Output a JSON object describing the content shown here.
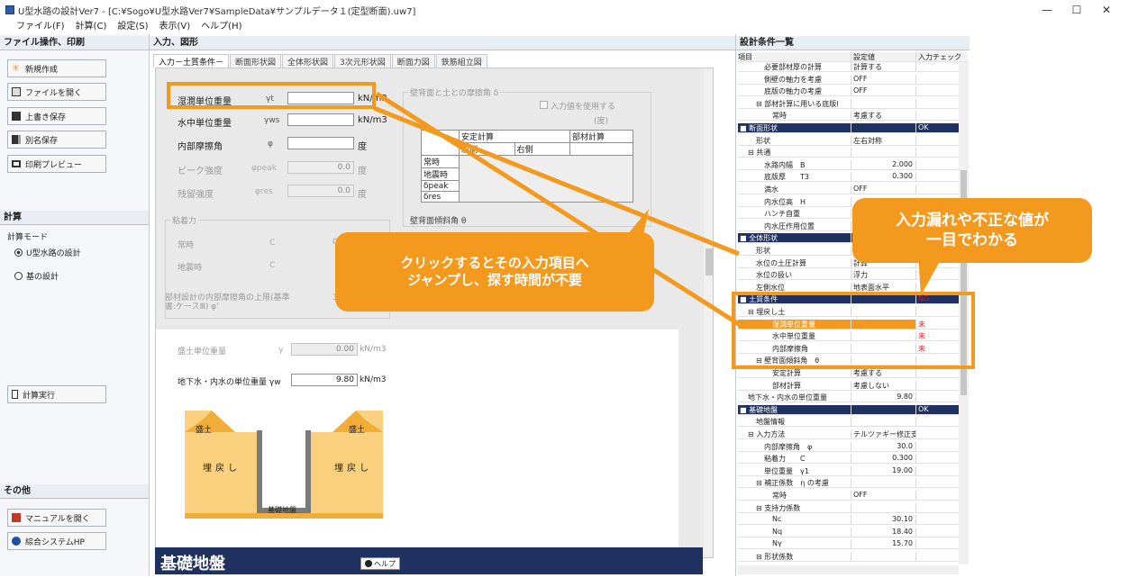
{
  "window": {
    "title": "U型水路の設計Ver7 - [C:¥Sogo¥U型水路Ver7¥SampleData¥サンプルデータ１(定型断面).uw7]",
    "minimize": "—",
    "maximize": "☐",
    "close": "✕"
  },
  "menu": [
    "ファイル(F)",
    "計算(C)",
    "設定(S)",
    "表示(V)",
    "ヘルプ(H)"
  ],
  "left": {
    "file_header": "ファイル操作、印刷",
    "buttons": [
      "新規作成",
      "ファイルを開く",
      "上書き保存",
      "別名保存",
      "印刷プレビュー"
    ],
    "calc_header": "計算",
    "calc_mode_label": "計算モード",
    "radio_u": "U型水路の設計",
    "radio_base": "基の設計",
    "run_label": "計算実行",
    "other_header": "その他",
    "manual_label": "マニュアルを開く",
    "hp_label": "綜合システムHP"
  },
  "center": {
    "header": "入力、図形",
    "tabs": [
      "入力－土質条件－",
      "断面形状図",
      "全体形状図",
      "3次元形状図",
      "断面力図",
      "鉄筋組立図"
    ],
    "fields": {
      "wet_unit_weight": {
        "label": "湿潤単位重量",
        "symbol": "γt",
        "value": "",
        "unit": "kN/m3"
      },
      "sub_unit_weight": {
        "label": "水中単位重量",
        "symbol": "γws",
        "value": "",
        "unit": "kN/m3"
      },
      "internal_friction": {
        "label": "内部摩擦角",
        "symbol": "φ",
        "value": "",
        "unit": "度"
      },
      "peak_strength": {
        "label": "ピーク強度",
        "symbol": "φpeak",
        "value": "0.0",
        "unit": "度"
      },
      "residual_strength": {
        "label": "残留強度",
        "symbol": "φres",
        "value": "0.0",
        "unit": "度"
      }
    },
    "wall_friction": {
      "title": "壁背面と土との摩擦角 δ",
      "checkbox_label": "入力値を使用する",
      "unit": "(度)",
      "header_stability": "安定計算",
      "header_member": "部材計算",
      "sub_left": "左側",
      "sub_right": "右側",
      "rows": [
        "常時",
        "地震時",
        "δpeak",
        "δres"
      ]
    },
    "cohesion": {
      "title": "粘着力",
      "normal": "常時",
      "quake": "地震時",
      "symbol": "C",
      "value": "0.00"
    },
    "wall_slope_title": "壁背面傾斜角 θ",
    "member_design_label": "部材設計の内部摩擦角の上限(基準書:ケースⅢ) φ'",
    "member_design_value": "30",
    "embank": {
      "label": "盛土単位重量",
      "symbol": "γ",
      "value": "0.00",
      "unit": "kN/m3"
    },
    "groundwater": {
      "label": "地下水・内水の単位重量 γw",
      "value": "9.80",
      "unit": "kN/m3"
    },
    "diagram": {
      "fill_left": "盛土",
      "fill_right": "盛土",
      "back_left": "埋戻し",
      "back_right": "埋戻し",
      "foundation": "基礎地盤"
    },
    "footer_title": "基礎地盤",
    "help": "ヘルプ"
  },
  "right": {
    "header": "設計条件一覧",
    "columns": [
      "項目",
      "設定値",
      "入力チェック"
    ],
    "rows": [
      {
        "name": "必要部材厚の計算",
        "value": "計算する",
        "check": "",
        "indent": 3
      },
      {
        "name": "側壁の軸力を考慮",
        "value": "OFF",
        "check": "",
        "indent": 3
      },
      {
        "name": "底版の軸力の考慮",
        "value": "OFF",
        "check": "",
        "indent": 3
      },
      {
        "name": "⊟ 部材計算に用いる底版l",
        "value": "",
        "check": "",
        "indent": 2
      },
      {
        "name": "常時",
        "value": "考慮する",
        "check": "",
        "indent": 4
      },
      {
        "name": "■ 断面形状",
        "value": "",
        "check": "OK",
        "section": true
      },
      {
        "name": "形状",
        "value": "左右対称",
        "check": "",
        "indent": 2
      },
      {
        "name": "⊟ 共通",
        "value": "",
        "check": "",
        "indent": 1
      },
      {
        "name": "水路内幅　B",
        "value": "2.000",
        "check": "",
        "indent": 3,
        "num": true
      },
      {
        "name": "底版厚　　T3",
        "value": "0.300",
        "check": "",
        "indent": 3,
        "num": true
      },
      {
        "name": "満水",
        "value": "OFF",
        "check": "",
        "indent": 3
      },
      {
        "name": "内水位高　H",
        "value": "",
        "check": "",
        "indent": 3
      },
      {
        "name": "ハンチ自重",
        "value": "",
        "check": "",
        "indent": 3
      },
      {
        "name": "内水圧作用位置",
        "value": "",
        "check": "",
        "indent": 3
      },
      {
        "name": "■ 全体形状",
        "value": "",
        "check": "",
        "section": true
      },
      {
        "name": "形状",
        "value": "",
        "check": "",
        "indent": 2
      },
      {
        "name": "水位の土圧計算",
        "value": "計算",
        "check": "",
        "indent": 2
      },
      {
        "name": "水位の扱い",
        "value": "浮力",
        "check": "",
        "indent": 2
      },
      {
        "name": "左側水位",
        "value": "地表面水平",
        "check": "",
        "indent": 2
      },
      {
        "name": "■ 土質条件",
        "value": "",
        "check": "NG",
        "section": true
      },
      {
        "name": "⊟ 埋戻し土",
        "value": "",
        "check": "",
        "indent": 1
      },
      {
        "name": "湿潤単位重量",
        "value": "",
        "check": "未",
        "indent": 4,
        "hl": true
      },
      {
        "name": "水中単位重量",
        "value": "",
        "check": "未",
        "indent": 4
      },
      {
        "name": "内部摩擦角",
        "value": "",
        "check": "未",
        "indent": 4
      },
      {
        "name": "⊟ 壁背面傾斜角　θ",
        "value": "",
        "check": "",
        "indent": 2
      },
      {
        "name": "安定計算",
        "value": "考慮する",
        "check": "",
        "indent": 4
      },
      {
        "name": "部材計算",
        "value": "考慮しない",
        "check": "",
        "indent": 4
      },
      {
        "name": "地下水・内水の単位重量",
        "value": "9.80",
        "check": "",
        "indent": 1,
        "num": true
      },
      {
        "name": "■ 基礎地盤",
        "value": "",
        "check": "OK",
        "section": true
      },
      {
        "name": "地盤情報",
        "value": "",
        "check": "",
        "indent": 2
      },
      {
        "name": "⊟ 入力方法",
        "value": "テルツァギー修正支",
        "check": "",
        "indent": 1
      },
      {
        "name": "内部摩擦角　φ",
        "value": "30.0",
        "check": "",
        "indent": 3,
        "num": true
      },
      {
        "name": "粘着力　　C",
        "value": "0.300",
        "check": "",
        "indent": 3,
        "num": true
      },
      {
        "name": "単位重量　γ1",
        "value": "19.00",
        "check": "",
        "indent": 3,
        "num": true
      },
      {
        "name": "⊟ 補正係数　η の考慮",
        "value": "",
        "check": "",
        "indent": 2
      },
      {
        "name": "常時",
        "value": "OFF",
        "check": "",
        "indent": 4
      },
      {
        "name": "⊟ 支持力係数",
        "value": "",
        "check": "",
        "indent": 2
      },
      {
        "name": "Nc",
        "value": "30.10",
        "check": "",
        "indent": 4,
        "num": true
      },
      {
        "name": "Nq",
        "value": "18.40",
        "check": "",
        "indent": 4,
        "num": true
      },
      {
        "name": "Nγ",
        "value": "15.70",
        "check": "",
        "indent": 4,
        "num": true
      },
      {
        "name": "⊟ 形状係数",
        "value": "",
        "check": "",
        "indent": 2
      }
    ]
  },
  "callouts": {
    "left": "クリックするとその入力項目へ\nジャンプし、探す時間が不要",
    "right": "入力漏れや不正な値が\n一目でわかる"
  },
  "colors": {
    "accent": "#f39a1e",
    "navy": "#1f3160"
  }
}
